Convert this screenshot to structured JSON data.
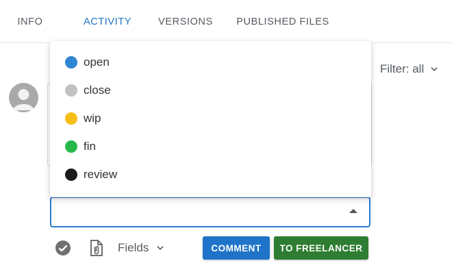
{
  "tabs": [
    {
      "label": "INFO",
      "active": false
    },
    {
      "label": "ACTIVITY",
      "active": true
    },
    {
      "label": "VERSIONS",
      "active": false
    },
    {
      "label": "PUBLISHED FILES",
      "active": false
    }
  ],
  "filter": {
    "label": "Filter: all",
    "icon": "chevron-down-icon"
  },
  "status_menu": {
    "items": [
      {
        "label": "open",
        "color": "#2f86d3"
      },
      {
        "label": "close",
        "color": "#c2c2c2"
      },
      {
        "label": "wip",
        "color": "#f6bd18"
      },
      {
        "label": "fin",
        "color": "#27b84a"
      },
      {
        "label": "review",
        "color": "#1c1c1c"
      }
    ]
  },
  "status_select": {
    "value": ""
  },
  "toolbar": {
    "check_icon": "check-circle-icon",
    "attach_icon": "attachment-icon",
    "fields_label": "Fields",
    "comment_label": "COMMENT",
    "freelancer_label": "TO FREELANCER"
  },
  "colors": {
    "accent": "#1f74c9",
    "success": "#2e7d32"
  }
}
